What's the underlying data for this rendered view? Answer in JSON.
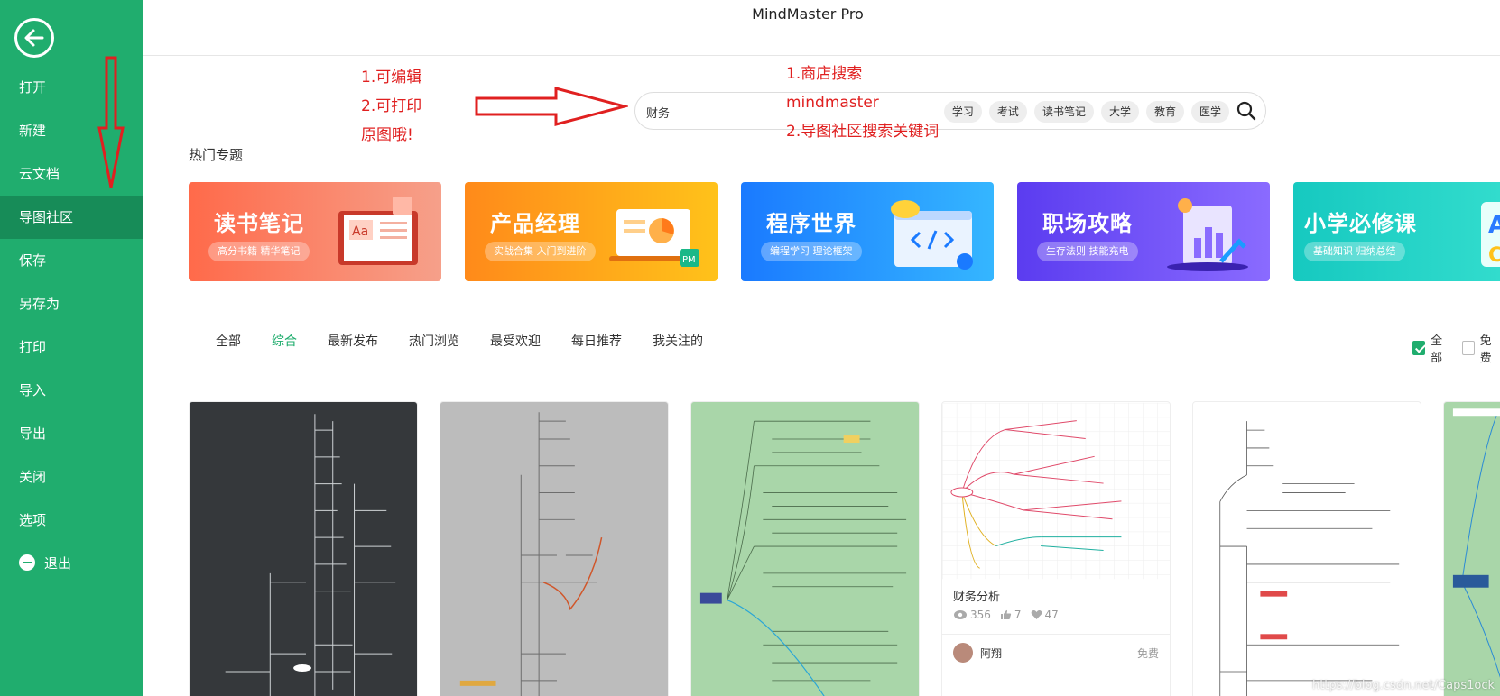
{
  "app": {
    "title": "MindMaster Pro"
  },
  "sidebar": {
    "items": [
      {
        "label": "打开"
      },
      {
        "label": "新建"
      },
      {
        "label": "云文档"
      },
      {
        "label": "导图社区",
        "active": true
      },
      {
        "label": "保存"
      },
      {
        "label": "另存为"
      },
      {
        "label": "打印"
      },
      {
        "label": "导入"
      },
      {
        "label": "导出"
      },
      {
        "label": "关闭"
      },
      {
        "label": "选项"
      },
      {
        "label": "退出",
        "icon": "minus-circle-icon"
      }
    ]
  },
  "search": {
    "value": "财务",
    "tags": [
      "学习",
      "考试",
      "读书笔记",
      "大学",
      "教育",
      "医学"
    ]
  },
  "annotations": {
    "left": [
      "1.可编辑",
      "2.可打印",
      "原图哦!"
    ],
    "right": [
      "1.商店搜索",
      "mindmaster",
      "2.导图社区搜索关键词"
    ],
    "color": "#e02020"
  },
  "hot_topics": {
    "title": "热门专题",
    "banners": [
      {
        "title": "读书笔记",
        "subtitle": "高分书籍 精华笔记",
        "color_from": "#ff6a4a",
        "color_to": "#f6a08a"
      },
      {
        "title": "产品经理",
        "subtitle": "实战合集 入门到进阶",
        "color_from": "#ff8a1a",
        "color_to": "#ffc21a"
      },
      {
        "title": "程序世界",
        "subtitle": "编程学习 理论框架",
        "color_from": "#1a7aff",
        "color_to": "#35b6ff"
      },
      {
        "title": "职场攻略",
        "subtitle": "生存法则 技能充电",
        "color_from": "#5b3cf0",
        "color_to": "#8a6bff"
      },
      {
        "title": "小学必修课",
        "subtitle": "基础知识 归纳总结",
        "color_from": "#16c9c0",
        "color_to": "#38e0d0"
      }
    ]
  },
  "filters": {
    "tabs": [
      "全部",
      "综合",
      "最新发布",
      "热门浏览",
      "最受欢迎",
      "每日推荐",
      "我关注的"
    ],
    "active_index": 1,
    "checkboxes": [
      {
        "label": "全部",
        "checked": true
      },
      {
        "label": "免费",
        "checked": false
      }
    ]
  },
  "cards": [
    {
      "bg": "#3a3a3a"
    },
    {
      "bg": "#bdbdbd"
    },
    {
      "bg": "#a8d5a8"
    },
    {
      "bg": "#ffffff",
      "title": "财务分析",
      "views": "356",
      "likes": "7",
      "favorites": "47",
      "author": "阿翔",
      "price": "免费"
    },
    {
      "bg": "#ffffff"
    },
    {
      "bg": "#a8d5a8"
    }
  ],
  "watermark": "https://blog.csdn.net/Caps1ock"
}
